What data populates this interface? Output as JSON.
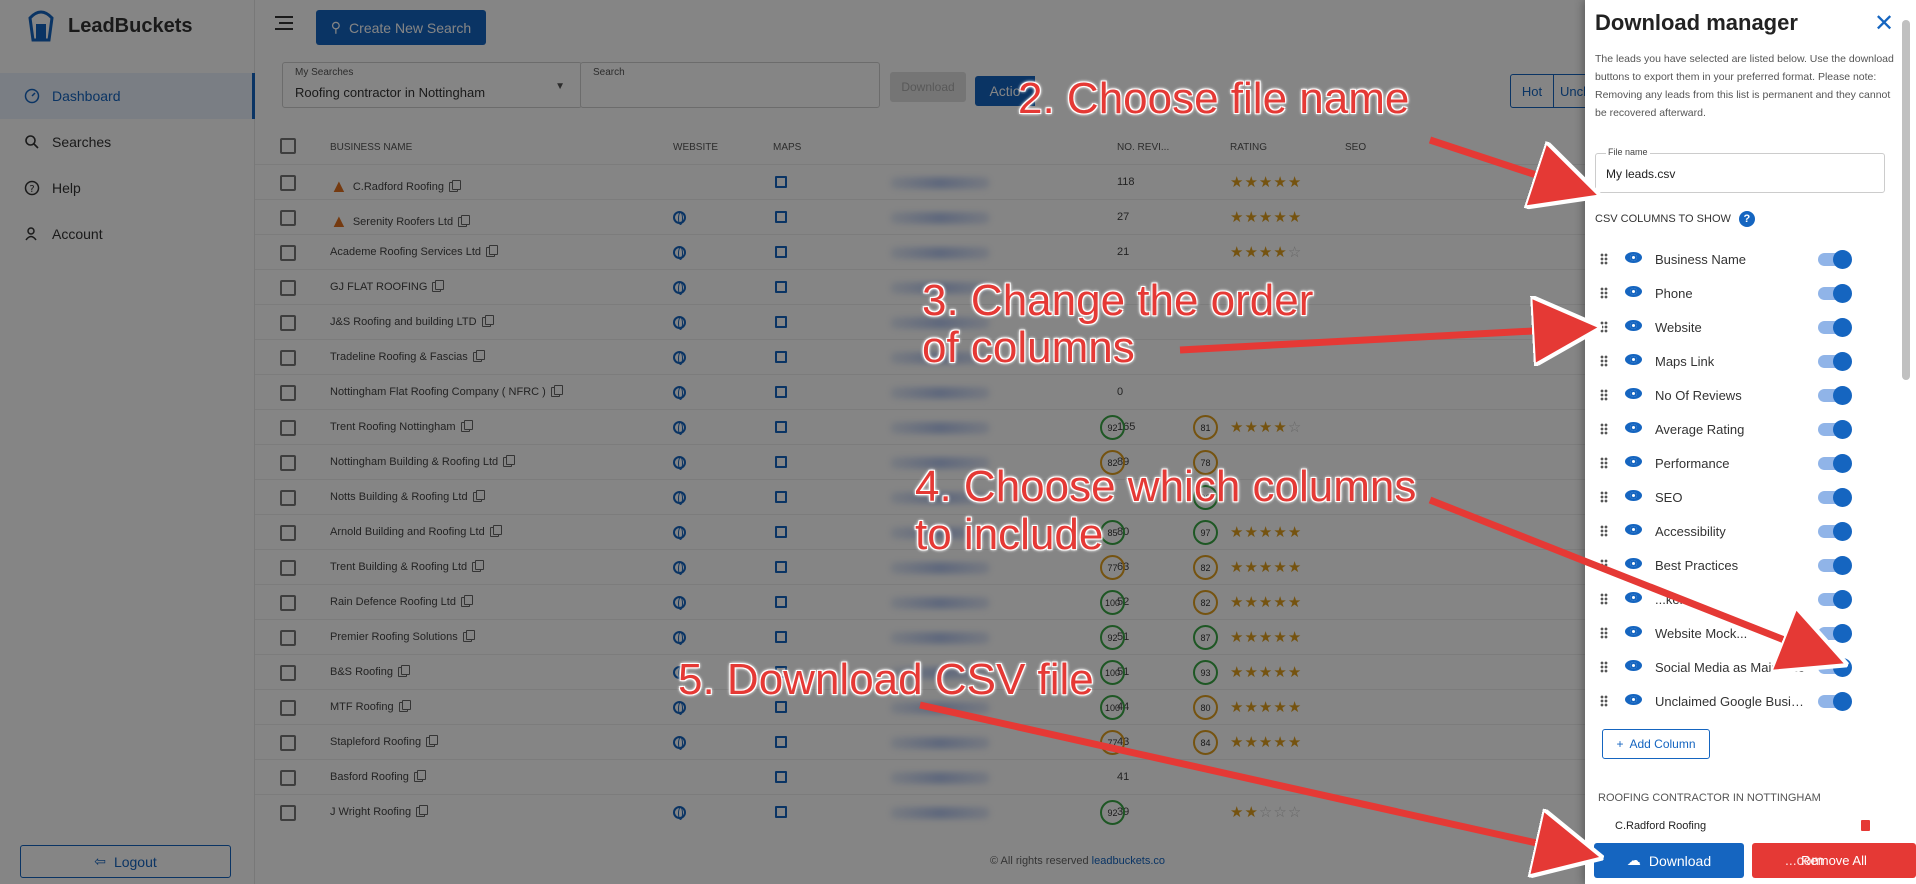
{
  "app": {
    "name": "LeadBuckets"
  },
  "sidebar": {
    "items": [
      {
        "label": "Dashboard"
      },
      {
        "label": "Searches"
      },
      {
        "label": "Help"
      },
      {
        "label": "Account"
      }
    ],
    "logout_label": "Logout"
  },
  "topbar": {
    "create_label": "Create New Search"
  },
  "filters": {
    "my_searches_label": "My Searches",
    "my_searches_value": "Roofing contractor in Nottingham",
    "search_label": "Search",
    "download_label": "Download",
    "actions_label": "Actio",
    "hot_label": "Hot",
    "unclaimed_label": "Uncl"
  },
  "table": {
    "headers": {
      "business_name": "BUSINESS NAME",
      "website": "WEBSITE",
      "maps": "MAPS",
      "reviews": "NO. REVI...",
      "rating": "RATING",
      "seo": "SEO"
    },
    "rows": [
      {
        "name": "C.Radford Roofing",
        "fire": true,
        "website": false,
        "reviews": "118",
        "rating": 5,
        "seo": "",
        "perf": ""
      },
      {
        "name": "Serenity Roofers Ltd",
        "fire": true,
        "website": true,
        "reviews": "27",
        "rating": 5,
        "seo": "",
        "perf": ""
      },
      {
        "name": "Academe Roofing Services Ltd",
        "fire": false,
        "website": true,
        "reviews": "21",
        "rating": 4,
        "seo": "",
        "perf": ""
      },
      {
        "name": "GJ FLAT ROOFING",
        "fire": false,
        "website": true,
        "reviews": "",
        "rating": 0,
        "seo": "",
        "perf": ""
      },
      {
        "name": "J&S Roofing and building LTD",
        "fire": false,
        "website": true,
        "reviews": "",
        "rating": 0,
        "seo": "",
        "perf": ""
      },
      {
        "name": "Tradeline Roofing & Fascias",
        "fire": false,
        "website": true,
        "reviews": "",
        "rating": 0,
        "seo": "",
        "perf": ""
      },
      {
        "name": "Nottingham Flat Roofing Company ( NFRC )",
        "fire": false,
        "website": true,
        "reviews": "0",
        "rating": 0,
        "seo": "",
        "perf": ""
      },
      {
        "name": "Trent Roofing Nottingham",
        "fire": false,
        "website": true,
        "reviews": "165",
        "rating": 4,
        "seo": "92",
        "perf": "81"
      },
      {
        "name": "Nottingham Building & Roofing Ltd",
        "fire": false,
        "website": true,
        "reviews": "89",
        "rating": 0,
        "seo": "82",
        "perf": "78"
      },
      {
        "name": "Notts Building & Roofing Ltd",
        "fire": false,
        "website": true,
        "reviews": "",
        "rating": 0,
        "seo": "",
        "perf": "92"
      },
      {
        "name": "Arnold Building and Roofing Ltd",
        "fire": false,
        "website": true,
        "reviews": "80",
        "rating": 5,
        "seo": "85",
        "perf": "97"
      },
      {
        "name": "Trent Building & Roofing Ltd",
        "fire": false,
        "website": true,
        "reviews": "63",
        "rating": 5,
        "seo": "77",
        "perf": "82"
      },
      {
        "name": "Rain Defence Roofing Ltd",
        "fire": false,
        "website": true,
        "reviews": "52",
        "rating": 5,
        "seo": "100",
        "perf": "82"
      },
      {
        "name": "Premier Roofing Solutions",
        "fire": false,
        "website": true,
        "reviews": "51",
        "rating": 5,
        "seo": "92",
        "perf": "87"
      },
      {
        "name": "B&S Roofing",
        "fire": false,
        "website": true,
        "reviews": "51",
        "rating": 5,
        "seo": "100",
        "perf": "93"
      },
      {
        "name": "MTF Roofing",
        "fire": false,
        "website": true,
        "reviews": "44",
        "rating": 5,
        "seo": "100",
        "perf": "80"
      },
      {
        "name": "Stapleford Roofing",
        "fire": false,
        "website": true,
        "reviews": "43",
        "rating": 5,
        "seo": "77",
        "perf": "84"
      },
      {
        "name": "Basford Roofing",
        "fire": false,
        "website": false,
        "reviews": "41",
        "rating": 0,
        "seo": "",
        "perf": ""
      },
      {
        "name": "J Wright Roofing",
        "fire": false,
        "website": true,
        "reviews": "39",
        "rating": 2,
        "seo": "92",
        "perf": ""
      }
    ]
  },
  "footer": {
    "text": "© All rights reserved",
    "link": "leadbuckets.co"
  },
  "panel": {
    "title": "Download manager",
    "description": "The leads you have selected are listed below. Use the download buttons to export them in your preferred format. Please note: Removing any leads from this list is permanent and they cannot be recovered afterward.",
    "file_name_label": "File name",
    "file_name_value": "My leads.csv",
    "csv_columns_label": "CSV COLUMNS TO SHOW",
    "columns": [
      {
        "label": "Business Name"
      },
      {
        "label": "Phone"
      },
      {
        "label": "Website"
      },
      {
        "label": "Maps Link"
      },
      {
        "label": "No Of Reviews"
      },
      {
        "label": "Average Rating"
      },
      {
        "label": "Performance"
      },
      {
        "label": "SEO"
      },
      {
        "label": "Accessibility"
      },
      {
        "label": "Best Practices"
      },
      {
        "label": "...ken"
      },
      {
        "label": "Website Mock..."
      },
      {
        "label": "Social Media as Main Site"
      },
      {
        "label": "Unclaimed Google Business Profile"
      }
    ],
    "add_column_label": "Add Column",
    "group_title": "ROOFING CONTRACTOR IN NOTTINGHAM",
    "lead_name": "C.Radford Roofing",
    "download_label": "Download",
    "remove_label": "Remove All"
  },
  "annotations": {
    "step2": "2. Choose file name",
    "step3_line1": "3. Change the order",
    "step3_line2": "of columns",
    "step4_line1": "4. Choose which columns",
    "step4_line2": "to include",
    "step5": "5. Download CSV file"
  },
  "watermark": "...com",
  "colors": {
    "accent": "#1565c0",
    "annotation": "#e53935",
    "star": "#e0a020",
    "score_green": "#3aa845",
    "score_orange": "#e0a020"
  }
}
